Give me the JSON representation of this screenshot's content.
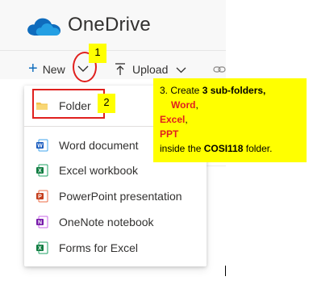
{
  "app": {
    "title": "OneDrive",
    "brand_color": "#0f6cbd"
  },
  "commandbar": {
    "new_label": "New",
    "upload_label": "Upload",
    "icons": [
      "plus-icon",
      "chevron-down-icon",
      "upload-icon",
      "link-icon"
    ]
  },
  "callouts": {
    "step1": "1",
    "step2": "2",
    "highlight_color": "#e0201e",
    "note_bg": "#ffff00"
  },
  "note": {
    "line1_prefix": "3. Create ",
    "line1_bold": "3 sub-folders,",
    "word": "Word",
    "excel": "Excel",
    "ppt": "PPT",
    "comma": ",",
    "last_prefix": "inside the ",
    "last_bold": "COSI118",
    "last_suffix": " folder."
  },
  "menu": {
    "items": [
      {
        "label": "Folder",
        "icon": "folder-icon",
        "color": "#f2c14a"
      },
      {
        "label": "Word document",
        "icon": "word-icon",
        "color": "#185abd"
      },
      {
        "label": "Excel workbook",
        "icon": "excel-icon",
        "color": "#107c41"
      },
      {
        "label": "PowerPoint presentation",
        "icon": "powerpoint-icon",
        "color": "#c43e1c"
      },
      {
        "label": "OneNote notebook",
        "icon": "onenote-icon",
        "color": "#7719aa"
      },
      {
        "label": "Forms for Excel",
        "icon": "forms-excel-icon",
        "color": "#107c41"
      }
    ]
  }
}
